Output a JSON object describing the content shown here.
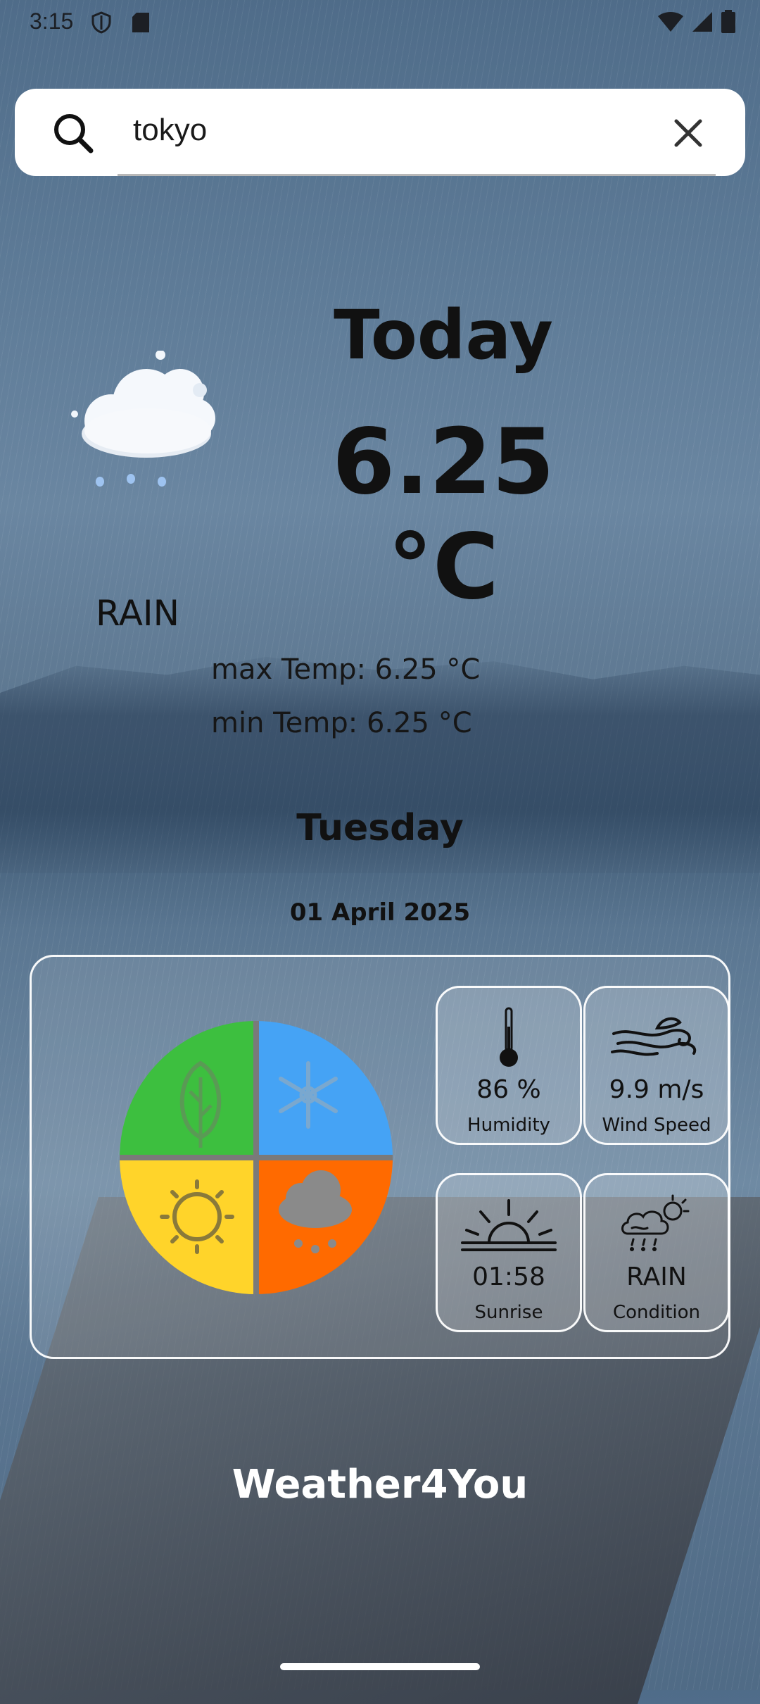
{
  "status_bar": {
    "time": "3:15",
    "left_icons": [
      "shield-icon",
      "sd-card-icon"
    ],
    "right_icons": [
      "wifi-icon",
      "signal-icon",
      "battery-icon"
    ]
  },
  "search": {
    "value": "tokyo",
    "search_icon": "search-icon",
    "clear_icon": "close-icon"
  },
  "current": {
    "heading": "Today",
    "temperature": "6.25 °C",
    "condition": "RAIN",
    "max_temp": "max Temp: 6.25 °C",
    "min_temp": "min Temp: 6.25 °C",
    "weather_icon": "rain-cloud-icon"
  },
  "date": {
    "weekday": "Tuesday",
    "full": "01 April 2025"
  },
  "details": {
    "seasons_icon": "seasons-icon",
    "tiles": [
      {
        "icon": "thermometer-icon",
        "value": "86 %",
        "label": "Humidity"
      },
      {
        "icon": "wind-icon",
        "value": "9.9 m/s",
        "label": "Wind Speed"
      },
      {
        "icon": "sunrise-icon",
        "value": "01:58",
        "label": "Sunrise"
      },
      {
        "icon": "rain-sun-cloud-icon",
        "value": "RAIN",
        "label": "Condition"
      }
    ]
  },
  "footer": {
    "brand": "Weather4You"
  },
  "colors": {
    "season_green": "#3dbf3f",
    "season_blue": "#45a3f5",
    "season_yellow": "#ffd42a",
    "season_orange": "#ff6a00",
    "text_dark": "#111111"
  }
}
